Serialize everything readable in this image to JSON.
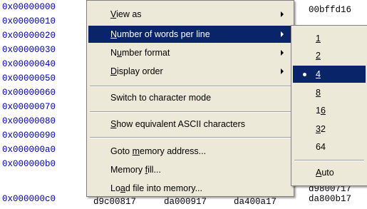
{
  "memory": {
    "addresses": [
      "0x00000000",
      "0x00000010",
      "0x00000020",
      "0x00000030",
      "0x00000040",
      "0x00000050",
      "0x00000060",
      "0x00000070",
      "0x00000080",
      "0x00000090",
      "0x000000a0",
      "0x000000b0",
      "0x000000c0"
    ],
    "right_column": {
      "row0": "00bffd16",
      "row11": "d9800717",
      "row12": "da800b17"
    },
    "bottom_row": [
      "d9c00817",
      "da000917",
      "da400a17"
    ]
  },
  "context_menu": {
    "items": [
      {
        "pre": "",
        "accel": "V",
        "post": "iew as",
        "submenu": true
      },
      {
        "pre": "",
        "accel": "N",
        "post": "umber of words per line",
        "submenu": true,
        "highlighted": true
      },
      {
        "pre": "N",
        "accel": "u",
        "post": "mber format",
        "submenu": true
      },
      {
        "pre": "",
        "accel": "D",
        "post": "isplay order",
        "submenu": true
      },
      {
        "pre": "Switch to character mode",
        "accel": "",
        "post": ""
      },
      {
        "pre": "",
        "accel": "S",
        "post": "how equivalent ASCII characters"
      },
      {
        "pre": "Goto ",
        "accel": "m",
        "post": "emory address..."
      },
      {
        "pre": "Memory ",
        "accel": "f",
        "post": "ill..."
      },
      {
        "pre": "Lo",
        "accel": "a",
        "post": "d file into memory..."
      }
    ]
  },
  "words_submenu": {
    "selected": "4",
    "items": [
      {
        "pre": "",
        "accel": "1",
        "post": ""
      },
      {
        "pre": "",
        "accel": "2",
        "post": ""
      },
      {
        "pre": "",
        "accel": "4",
        "post": ""
      },
      {
        "pre": "",
        "accel": "8",
        "post": ""
      },
      {
        "pre": "1",
        "accel": "6",
        "post": ""
      },
      {
        "pre": "",
        "accel": "3",
        "post": "2"
      },
      {
        "pre": "64",
        "accel": "",
        "post": ""
      },
      {
        "pre": "",
        "accel": "A",
        "post": "uto"
      }
    ]
  },
  "colors": {
    "address_text": "#0000a0",
    "menu_background": "#ece9d8",
    "highlight": "#0a246a"
  }
}
